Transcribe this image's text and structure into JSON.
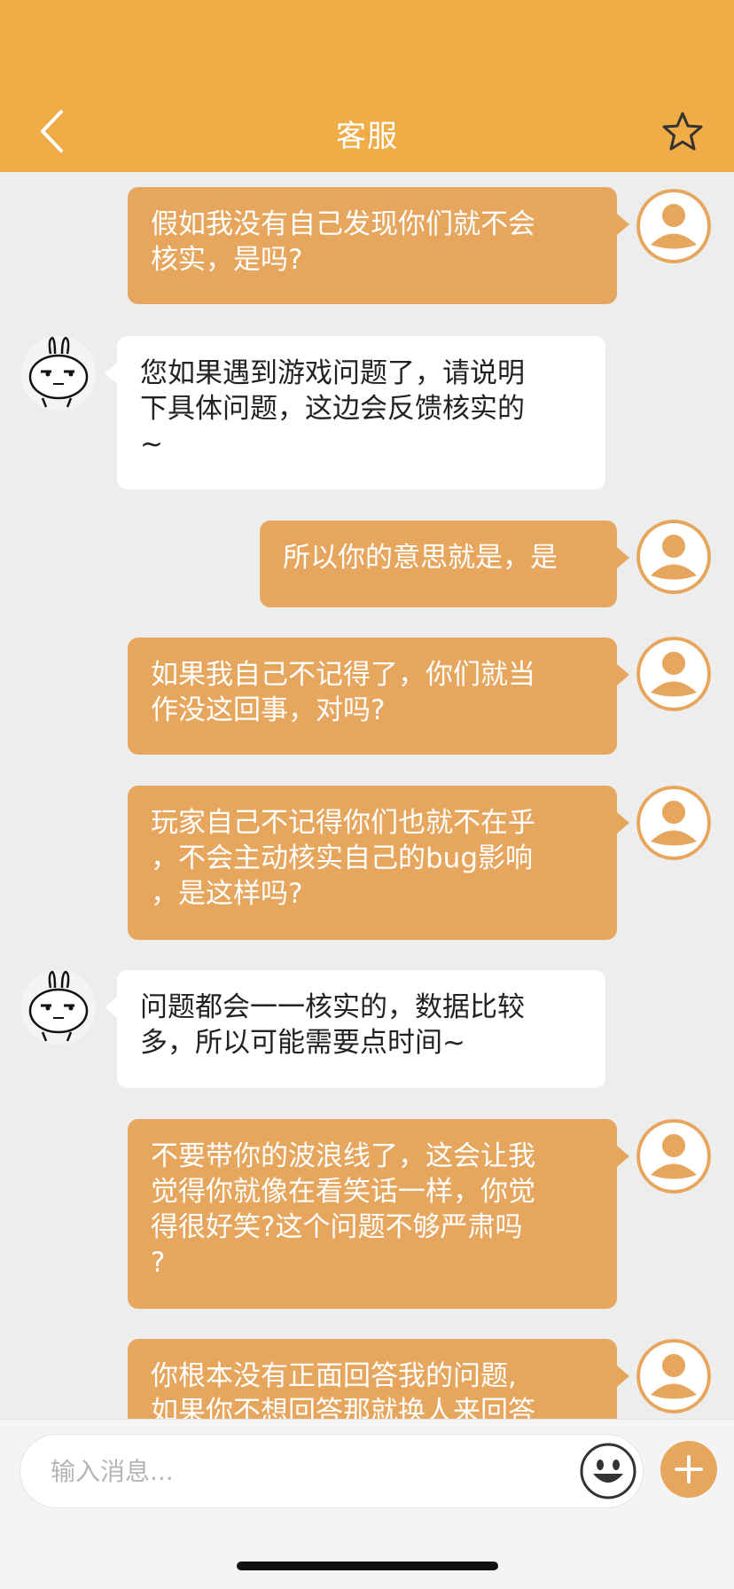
{
  "header": {
    "title": "客服",
    "back_icon": "chevron-left-icon",
    "favorite_icon": "star-outline-icon",
    "color": "#f0ac47"
  },
  "colors": {
    "user_bubble": "#e6a65d",
    "agent_bubble": "#ffffff",
    "background": "#ededed"
  },
  "messages": [
    {
      "sender": "user",
      "text": "假如我没有自己发现你们就不会\n核实，是吗?"
    },
    {
      "sender": "agent",
      "text": "您如果遇到游戏问题了，请说明\n下具体问题，这边会反馈核实的\n~"
    },
    {
      "sender": "user",
      "text": "所以你的意思就是，是"
    },
    {
      "sender": "user",
      "text": "如果我自己不记得了，你们就当\n作没这回事，对吗?"
    },
    {
      "sender": "user",
      "text": "玩家自己不记得你们也就不在乎\n，不会主动核实自己的bug影响\n，是这样吗?"
    },
    {
      "sender": "agent",
      "text": "问题都会一一核实的，数据比较\n多，所以可能需要点时间~"
    },
    {
      "sender": "user",
      "text": "不要带你的波浪线了，这会让我\n觉得你就像在看笑话一样，你觉\n得很好笑?这个问题不够严肃吗\n?"
    },
    {
      "sender": "user",
      "text": "你根本没有正面回答我的问题,\n如果你不想回答那就换人来回答"
    }
  ],
  "input": {
    "placeholder": "输入消息...",
    "emoji_icon": "smiley-face-icon",
    "plus_icon": "plus-icon"
  }
}
